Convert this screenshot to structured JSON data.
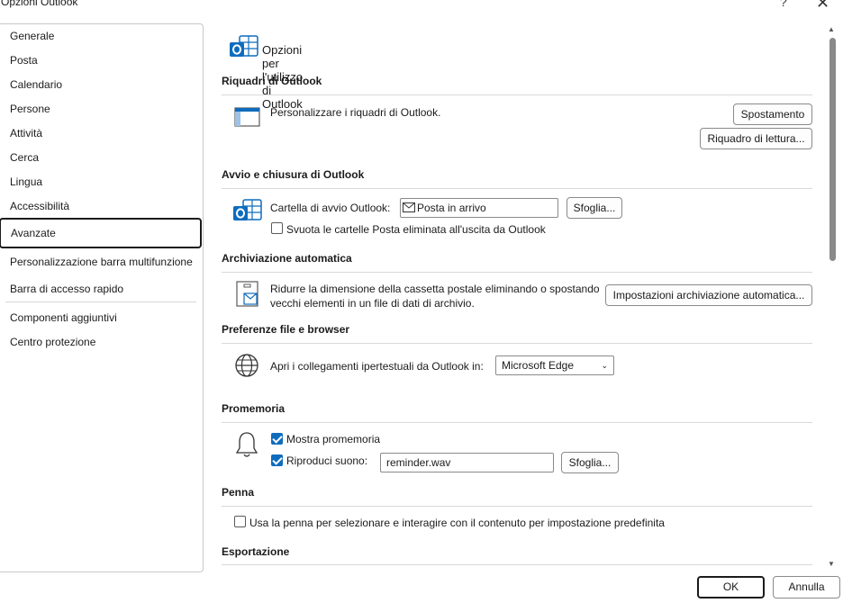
{
  "window": {
    "title": "Opzioni Outlook",
    "help_glyph": "?",
    "close_glyph": "✕"
  },
  "sidebar": {
    "items": [
      {
        "label": "Generale"
      },
      {
        "label": "Posta"
      },
      {
        "label": "Calendario"
      },
      {
        "label": "Persone"
      },
      {
        "label": "Attività"
      },
      {
        "label": "Cerca"
      },
      {
        "label": "Lingua"
      },
      {
        "label": "Accessibilità"
      },
      {
        "label": "Avanzate",
        "selected": true
      },
      {
        "label": "Personalizzazione barra multifunzione"
      },
      {
        "label": "Barra di accesso rapido"
      },
      {
        "label": "Componenti aggiuntivi"
      },
      {
        "label": "Centro protezione"
      }
    ]
  },
  "main": {
    "heading": "Opzioni per l'utilizzo di Outlook",
    "panes": {
      "title": "Riquadri di Outlook",
      "description": "Personalizzare i riquadri di Outlook.",
      "move_button": "Spostamento",
      "reading_pane_button": "Riquadro di lettura..."
    },
    "startup": {
      "title": "Avvio e chiusura di Outlook",
      "start_folder_label": "Cartella di avvio Outlook:",
      "start_folder_value": "Posta in arrivo",
      "browse_button": "Sfoglia...",
      "empty_deleted_label": "Svuota le cartelle Posta eliminata all'uscita da Outlook",
      "empty_deleted_checked": false
    },
    "autoarchive": {
      "title": "Archiviazione automatica",
      "description_line1": "Ridurre la dimensione della cassetta postale eliminando o spostando",
      "description_line2": "vecchi elementi in un file di dati di archivio.",
      "settings_button": "Impostazioni archiviazione automatica..."
    },
    "browser": {
      "title": "Preferenze file e browser",
      "open_links_label": "Apri i collegamenti ipertestuali da Outlook in:",
      "browser_value": "Microsoft Edge"
    },
    "reminders": {
      "title": "Promemoria",
      "show_label": "Mostra promemoria",
      "show_checked": true,
      "play_sound_label": "Riproduci suono:",
      "play_sound_checked": true,
      "sound_file": "reminder.wav",
      "browse_button": "Sfoglia..."
    },
    "pen": {
      "title": "Penna",
      "use_pen_label": "Usa la penna per selezionare e interagire con il contenuto per impostazione predefinita",
      "use_pen_checked": false
    },
    "export": {
      "title": "Esportazione"
    }
  },
  "footer": {
    "ok_button": "OK",
    "cancel_button": "Annulla"
  },
  "colors": {
    "accent": "#0f6cbd",
    "outlook_blue": "#0f6cbd"
  }
}
